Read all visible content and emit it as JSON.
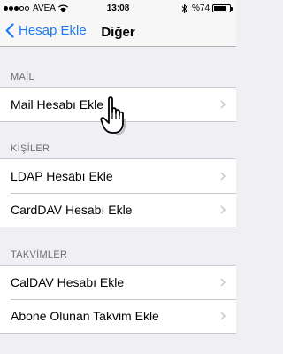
{
  "status_bar": {
    "carrier": "AVEA",
    "time": "13:08",
    "battery": "%74",
    "battery_level": 0.74
  },
  "nav": {
    "back_label": "Hesap Ekle",
    "title": "Diğer"
  },
  "sections": [
    {
      "header": "MAİL",
      "rows": [
        "Mail Hesabı Ekle"
      ]
    },
    {
      "header": "KİŞİLER",
      "rows": [
        "LDAP Hesabı Ekle",
        "CardDAV Hesabı Ekle"
      ]
    },
    {
      "header": "TAKVİMLER",
      "rows": [
        "CalDAV Hesabı Ekle",
        "Abone Olunan Takvim Ekle"
      ]
    }
  ],
  "colors": {
    "accent": "#1a7cf5",
    "background": "#efeff4",
    "section_header": "#6d6d72",
    "separator": "#c8c7cc",
    "chevron": "#c7c7cc"
  },
  "icons": [
    "signal-dots-icon",
    "wifi-icon",
    "bluetooth-icon",
    "battery-icon",
    "back-chevron-icon",
    "chevron-right-icon",
    "hand-pointer-cursor-icon"
  ]
}
